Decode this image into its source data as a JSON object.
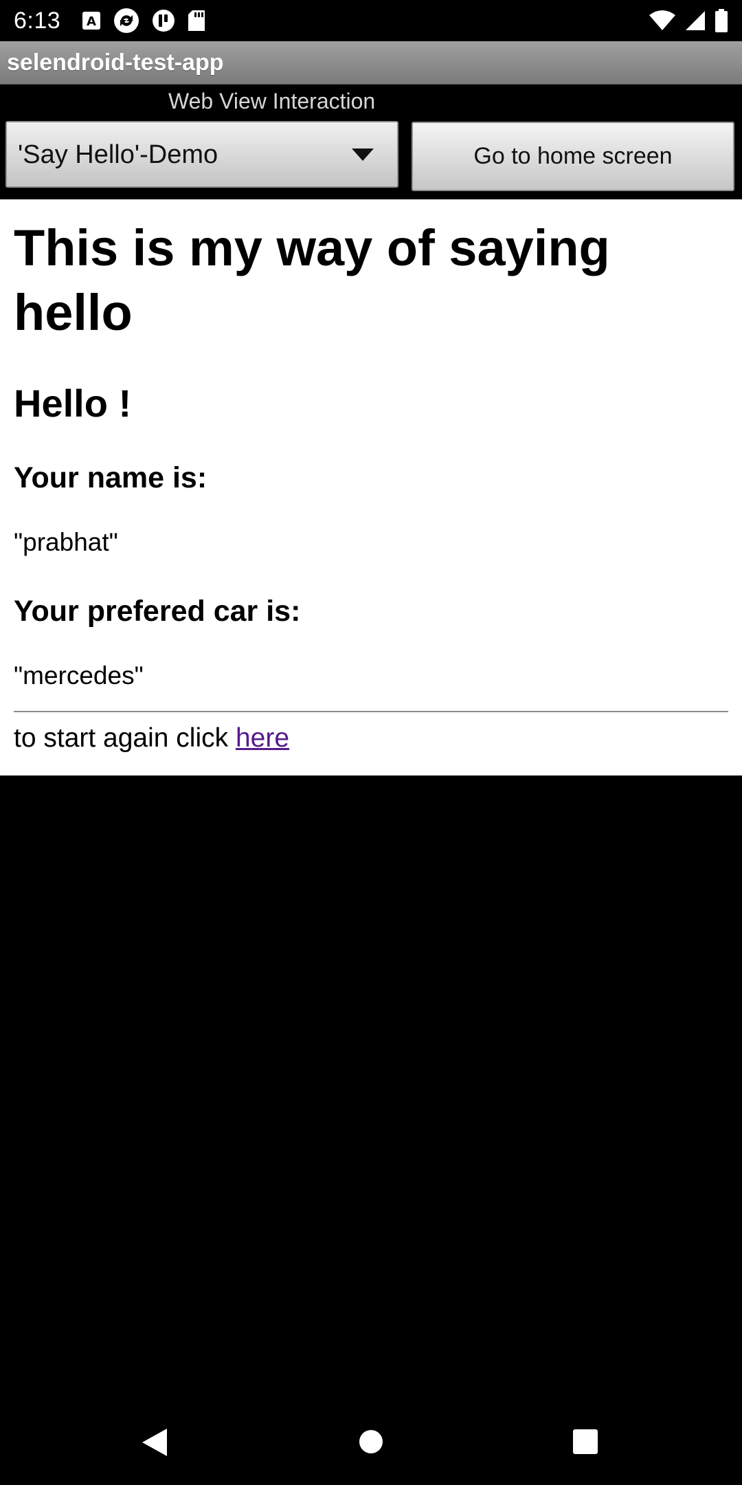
{
  "status_bar": {
    "time": "6:13",
    "left_icons": [
      "a-notification-icon",
      "sync-icon",
      "pocket-icon",
      "sd-card-icon"
    ],
    "right_icons": [
      "wifi-icon",
      "cell-signal-icon",
      "battery-icon"
    ]
  },
  "app": {
    "title": "selendroid-test-app"
  },
  "header": {
    "subtitle": "Web View Interaction",
    "spinner": {
      "selected": "'Say Hello'-Demo"
    },
    "home_button_label": "Go to home screen"
  },
  "webview": {
    "title": "This is my way of saying hello",
    "greeting": "Hello !",
    "name_label": "Your name is:",
    "name_value": "\"prabhat\"",
    "car_label": "Your prefered car is:",
    "car_value": "\"mercedes\"",
    "footer_text": "to start again click ",
    "footer_link": "here"
  },
  "colors": {
    "link": "#551a8b",
    "title_bar_top": "#a0a0a0",
    "title_bar_bottom": "#7b7b7b",
    "background": "#000000"
  },
  "nav_bar": {
    "icons": [
      "back-icon",
      "home-icon",
      "recents-icon"
    ]
  }
}
